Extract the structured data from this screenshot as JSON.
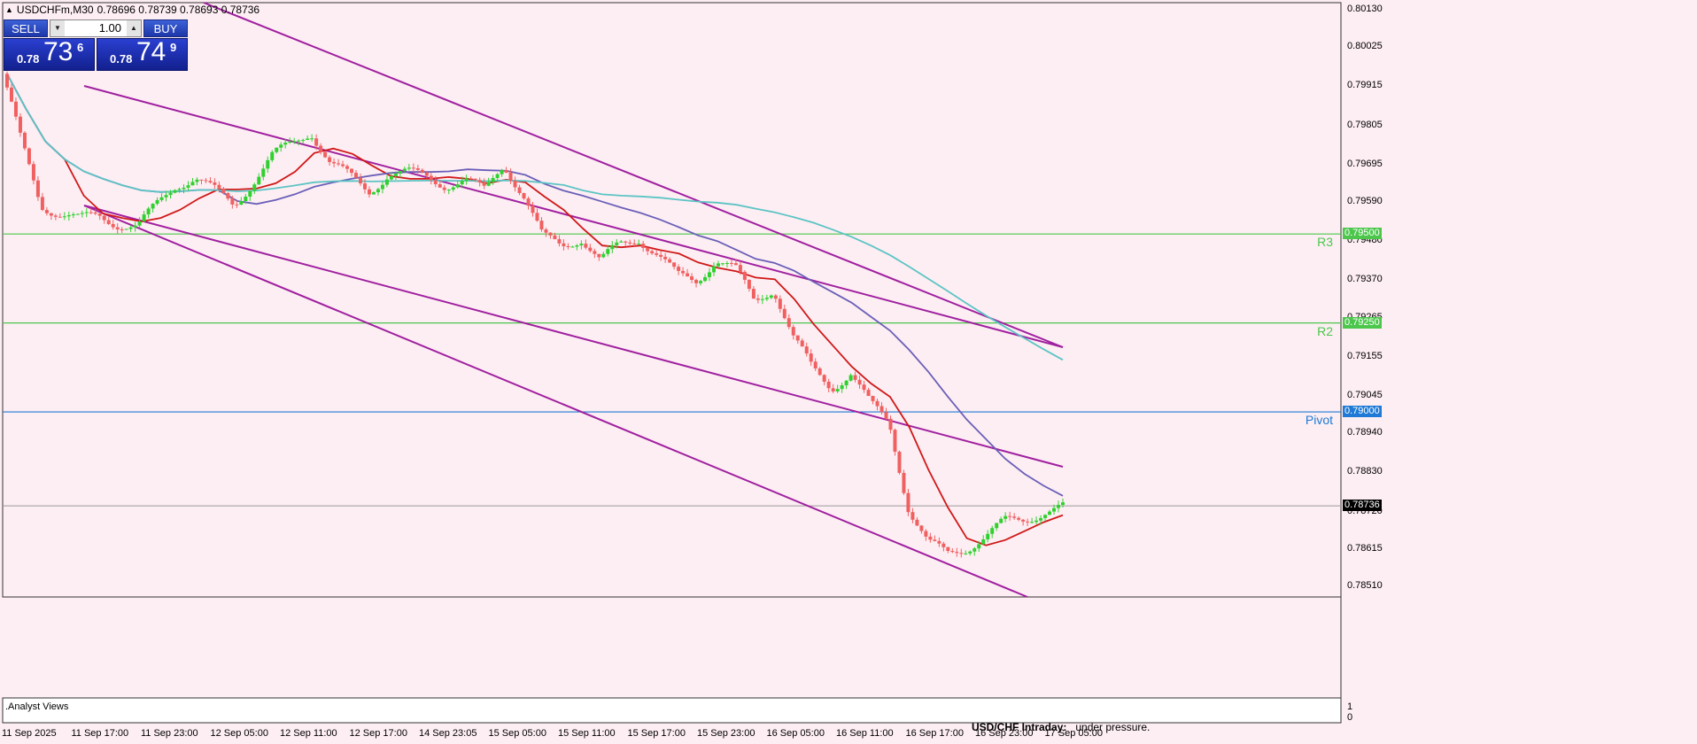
{
  "header": {
    "symbol_info": "USDCHFm,M30",
    "ohlc": "0.78696 0.78739 0.78693 0.78736"
  },
  "trade_panel": {
    "sell_label": "SELL",
    "buy_label": "BUY",
    "lot": "1.00",
    "bid_prefix": "0.78",
    "bid_big": "73",
    "bid_sup": "6",
    "ask_prefix": "0.78",
    "ask_big": "74",
    "ask_sup": "9"
  },
  "price_axis": {
    "ticks": [
      "0.80130",
      "0.80025",
      "0.79915",
      "0.79805",
      "0.79695",
      "0.79590",
      "0.79480",
      "0.79370",
      "0.79265",
      "0.79155",
      "0.79045",
      "0.78940",
      "0.78830",
      "0.78720",
      "0.78615",
      "0.78510"
    ],
    "current_price": "0.78736",
    "subwindow_ticks": [
      "1",
      "0"
    ]
  },
  "levels": [
    {
      "name": "R3",
      "price": "0.79500",
      "color": "#4cc74c"
    },
    {
      "name": "R2",
      "price": "0.79250",
      "color": "#4cc74c"
    },
    {
      "name": "Pivot",
      "price": "0.79000",
      "color": "#1e7ad6"
    }
  ],
  "time_axis": [
    "11 Sep 2025",
    "11 Sep 17:00",
    "11 Sep 23:00",
    "12 Sep 05:00",
    "12 Sep 11:00",
    "12 Sep 17:00",
    "14 Sep 23:05",
    "15 Sep 05:00",
    "15 Sep 11:00",
    "15 Sep 17:00",
    "15 Sep 23:00",
    "16 Sep 05:00",
    "16 Sep 11:00",
    "16 Sep 17:00",
    "16 Sep 23:00",
    "17 Sep 05:00"
  ],
  "subwindow": {
    "label": ".Analyst Views",
    "note_bold": "USD/CHF Intraday:",
    "note_rest": "under pressure."
  },
  "colors": {
    "background": "#fdeef3",
    "bull": "#2fd12f",
    "bear": "#f06060",
    "ma_fast": "#d01818",
    "ma_mid": "#6a5fb8",
    "ma_slow": "#5cc4c4",
    "channel": "#a020a0"
  },
  "chart_data": {
    "type": "candlestick",
    "symbol": "USDCHFm",
    "timeframe": "M30",
    "ylim": [
      0.7848,
      0.8015
    ],
    "close_path": [
      0.7995,
      0.7975,
      0.7958,
      0.7956,
      0.7954,
      0.7955,
      0.7953,
      0.7952,
      0.7958,
      0.7964,
      0.7966,
      0.7962,
      0.7958,
      0.7965,
      0.7972,
      0.7975,
      0.7979,
      0.797,
      0.7966,
      0.7962,
      0.7967,
      0.7967,
      0.7966,
      0.7964,
      0.7965,
      0.7962,
      0.797,
      0.7961,
      0.7949,
      0.7947,
      0.7949,
      0.7942,
      0.7947,
      0.7949,
      0.7944,
      0.7938,
      0.7937,
      0.7943,
      0.794,
      0.7931,
      0.7935,
      0.7921,
      0.7912,
      0.7907,
      0.7911,
      0.7902,
      0.7897,
      0.7873,
      0.7863,
      0.786,
      0.7862,
      0.7865,
      0.7869,
      0.787,
      0.7872,
      0.7873
    ]
  }
}
